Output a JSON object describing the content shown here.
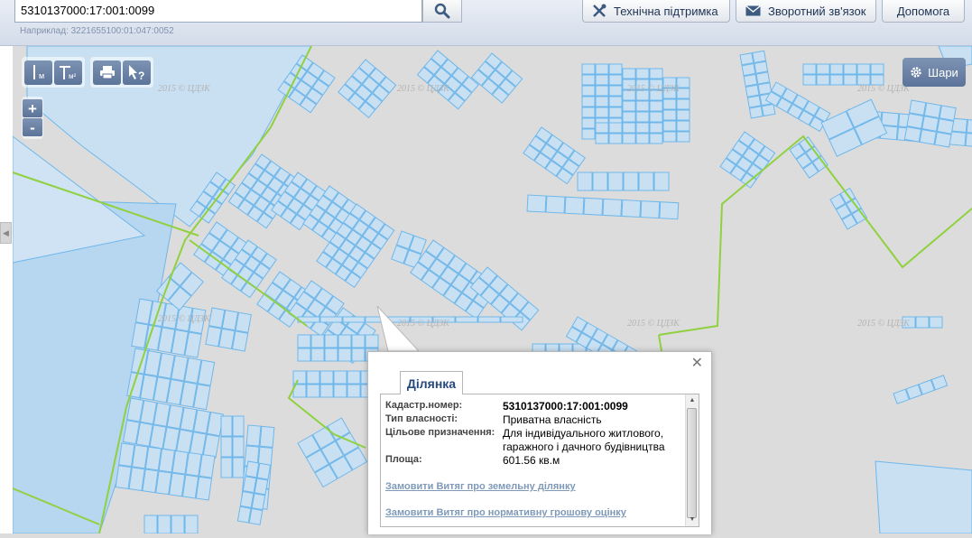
{
  "search": {
    "value": "5310137000:17:001:0099",
    "example": "Наприклад: 3221655100:01:047:0052"
  },
  "header_buttons": [
    {
      "label": "Технічна підтримка",
      "icon": "tools-icon"
    },
    {
      "label": "Зворотний зв'язок",
      "icon": "envelope-icon"
    },
    {
      "label": "Допомога"
    }
  ],
  "toolbar": {
    "measure_length_label": "м",
    "measure_area_label": "м²",
    "identify_label": "?"
  },
  "zoom": {
    "in": "+",
    "out": "-"
  },
  "layers_button": {
    "label": "Шари",
    "icon": "gear-icon"
  },
  "watermark": "2015 © ЦДЗК",
  "popup": {
    "tab": "Ділянка",
    "fields": [
      {
        "label": "Кадастр.номер:",
        "value": "5310137000:17:001:0099"
      },
      {
        "label": "Тип власності:",
        "value": "Приватна власність"
      },
      {
        "label": "Цільове призначення:",
        "value": "Для індивідуального житлового, гаражного і дачного будівництва"
      },
      {
        "label": "Площа:",
        "value": "601.56 кв.м"
      }
    ],
    "links": [
      "Замовити Витяг про земельну ділянку",
      "Замовити Витяг про нормативну грошову оцінку"
    ]
  },
  "colors": {
    "map_background": "#dcdcdc",
    "parcel_fill": "#c9e0f3",
    "parcel_stroke": "#6fb7ea",
    "boundary": "#8fd13f",
    "link": "#7f9ab8"
  }
}
